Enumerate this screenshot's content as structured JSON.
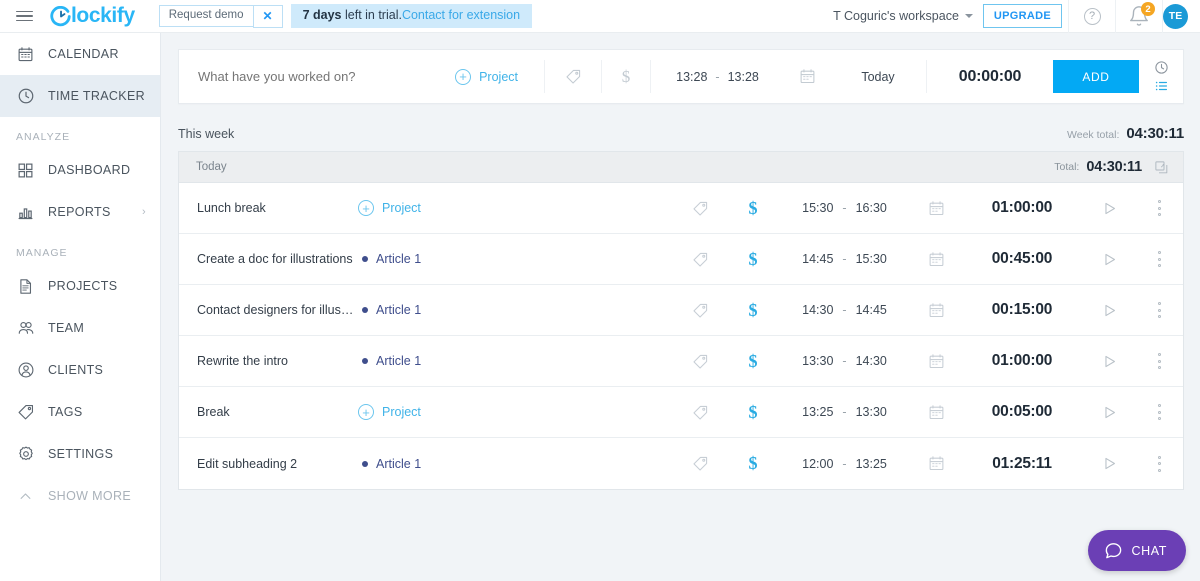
{
  "topbar": {
    "menu_icon": "hamburger-icon",
    "logo_text": "lockify",
    "logo_full": "Clockify",
    "request_demo_label": "Request demo",
    "close_label": "×",
    "trial_days": "7 days",
    "trial_text": " left in trial.",
    "trial_link": "Contact for extension",
    "workspace": "T Coguric's workspace",
    "upgrade_label": "UPGRADE",
    "help_label": "?",
    "notification_count": "2",
    "avatar_initials": "TE"
  },
  "sidebar": {
    "items": [
      {
        "label": "CALENDAR",
        "icon": "calendar-icon",
        "active": false
      },
      {
        "label": "TIME TRACKER",
        "icon": "clock-icon",
        "active": true
      }
    ],
    "group_analyze": "ANALYZE",
    "analyze_items": [
      {
        "label": "DASHBOARD",
        "icon": "dashboard-grid-icon",
        "chevron": false
      },
      {
        "label": "REPORTS",
        "icon": "bar-chart-icon",
        "chevron": true
      }
    ],
    "group_manage": "MANAGE",
    "manage_items": [
      {
        "label": "PROJECTS",
        "icon": "document-icon"
      },
      {
        "label": "TEAM",
        "icon": "team-icon"
      },
      {
        "label": "CLIENTS",
        "icon": "user-circle-icon"
      },
      {
        "label": "TAGS",
        "icon": "tag-icon"
      },
      {
        "label": "SETTINGS",
        "icon": "gear-icon"
      }
    ],
    "show_more": "SHOW MORE",
    "show_more_icon": "chevron-up-icon"
  },
  "timer": {
    "placeholder": "What have you worked on?",
    "description_value": "",
    "project_label": "Project",
    "tag_icon": "tag-icon",
    "billable_icon": "dollar-icon",
    "start_time": "13:28",
    "time_dash": "-",
    "end_time": "13:28",
    "calendar_icon": "calendar-icon",
    "date_label": "Today",
    "duration": "00:00:00",
    "add_label": "ADD",
    "mode_timer_icon": "clock-icon",
    "mode_manual_icon": "list-icon"
  },
  "week": {
    "title": "This week",
    "total_label": "Week total:",
    "total_value": "04:30:11"
  },
  "day": {
    "label": "Today",
    "total_label": "Total:",
    "total_value": "04:30:11",
    "copy_icon": "duplicate-icon"
  },
  "entries": [
    {
      "description": "Lunch break",
      "project": "Project",
      "project_empty": true,
      "start": "15:30",
      "end": "16:30",
      "duration": "01:00:00"
    },
    {
      "description": "Create a doc for illustrations",
      "project": "Article 1",
      "project_empty": false,
      "start": "14:45",
      "end": "15:30",
      "duration": "00:45:00"
    },
    {
      "description": "Contact designers for illustrations",
      "project": "Article 1",
      "project_empty": false,
      "start": "14:30",
      "end": "14:45",
      "duration": "00:15:00"
    },
    {
      "description": "Rewrite the intro",
      "project": "Article 1",
      "project_empty": false,
      "start": "13:30",
      "end": "14:30",
      "duration": "01:00:00"
    },
    {
      "description": "Break",
      "project": "Project",
      "project_empty": true,
      "start": "13:25",
      "end": "13:30",
      "duration": "00:05:00"
    },
    {
      "description": "Edit subheading 2",
      "project": "Article 1",
      "project_empty": false,
      "start": "12:00",
      "end": "13:25",
      "duration": "01:25:11"
    }
  ],
  "entry_row": {
    "time_dash": "-",
    "tag_icon": "tag-icon",
    "billable_icon": "dollar-icon",
    "calendar_icon": "calendar-icon",
    "play_icon": "play-icon",
    "more_icon": "more-vertical-icon"
  },
  "chat": {
    "label": "CHAT",
    "icon": "chat-bubble-icon"
  },
  "colors": {
    "accent": "#03a9f4",
    "link": "#40b3e8",
    "project_named": "#3f4e8c",
    "billable_active": "#29abe2",
    "badge": "#f5a623",
    "chat": "#6b3fb5",
    "banner_bg": "#cfeafb",
    "page_bg": "#f1f4f7"
  }
}
